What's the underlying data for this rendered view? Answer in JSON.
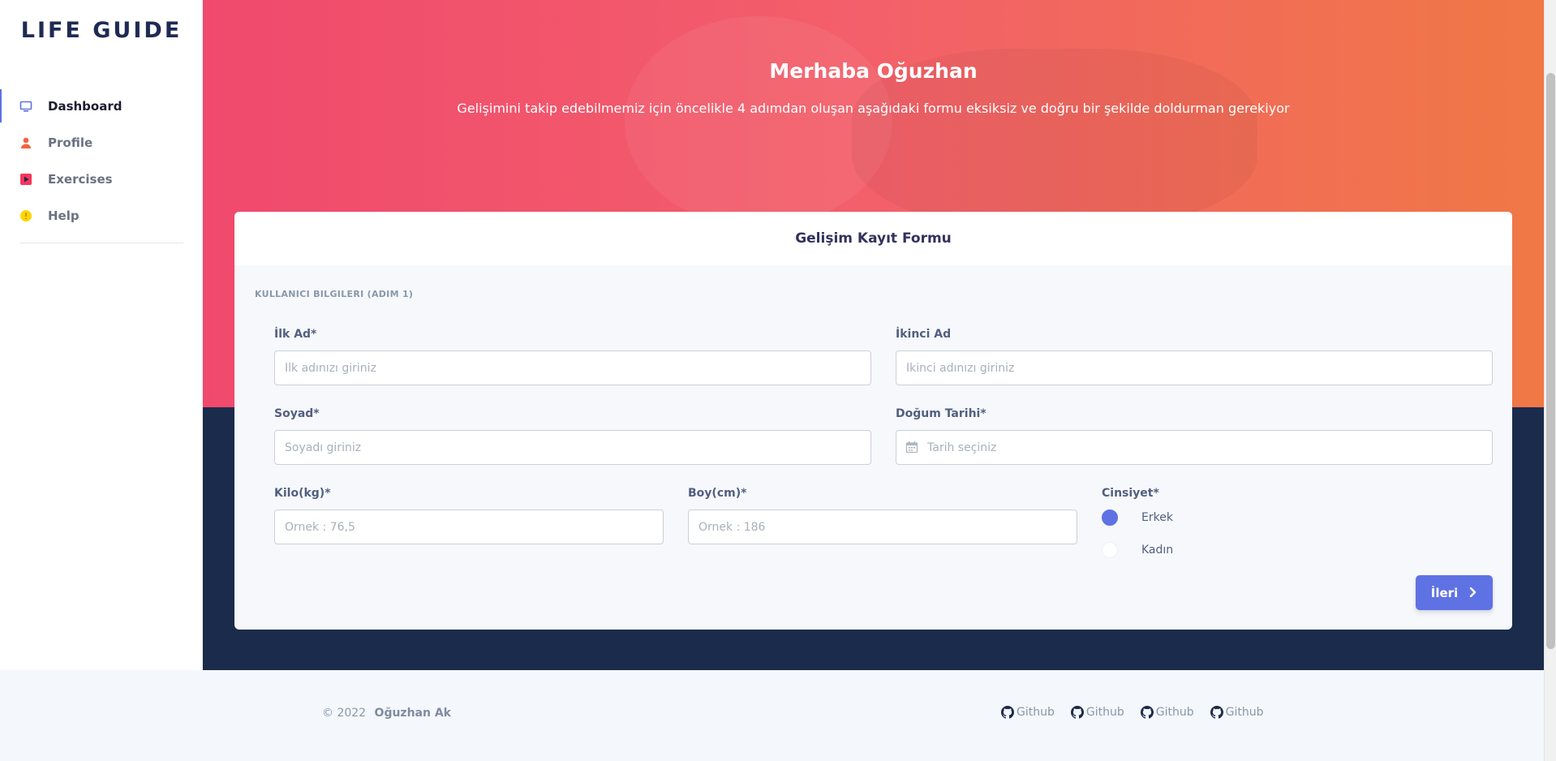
{
  "brand": "LIFE GUIDE",
  "sidebar": {
    "items": [
      {
        "label": "Dashboard",
        "icon": "monitor-icon",
        "color": "#5e72e4",
        "active": true
      },
      {
        "label": "Profile",
        "icon": "user-icon",
        "color": "#f3643f",
        "active": false
      },
      {
        "label": "Exercises",
        "icon": "play-icon",
        "color": "#f5365c",
        "active": false
      },
      {
        "label": "Help",
        "icon": "info-icon",
        "color": "#ffd600",
        "active": false
      }
    ]
  },
  "hero": {
    "title": "Merhaba Oğuzhan",
    "subtitle": "Gelişimini takip edebilmemiz için öncelikle 4 adımdan oluşan aşağıdaki formu eksiksiz ve doğru bir şekilde doldurman gerekiyor"
  },
  "form": {
    "title": "Gelişim Kayıt Formu",
    "step_heading": "KULLANICI BILGILERI (ADIM 1)",
    "first_name": {
      "label": "İlk Ad*",
      "placeholder": "İlk adınızı giriniz"
    },
    "middle_name": {
      "label": "İkinci Ad",
      "placeholder": "İkinci adınızı giriniz"
    },
    "last_name": {
      "label": "Soyad*",
      "placeholder": "Soyadı giriniz"
    },
    "birth_date": {
      "label": "Doğum Tarihi*",
      "placeholder": "Tarih seçiniz"
    },
    "weight": {
      "label": "Kilo(kg)*",
      "placeholder": "Örnek : 76,5"
    },
    "height": {
      "label": "Boy(cm)*",
      "placeholder": "Örnek : 186"
    },
    "gender": {
      "label": "Cinsiyet*",
      "options": [
        {
          "label": "Erkek",
          "checked": true
        },
        {
          "label": "Kadın",
          "checked": false
        }
      ]
    },
    "next_button": "İleri"
  },
  "footer": {
    "copyright": "© 2022",
    "author": "Oğuzhan Ak",
    "links": [
      "Github",
      "Github",
      "Github",
      "Github"
    ]
  },
  "colors": {
    "accent": "#5e72e4",
    "hero_start": "#f0496d",
    "hero_end": "#f07845",
    "dark_band": "#1b2b4b"
  }
}
